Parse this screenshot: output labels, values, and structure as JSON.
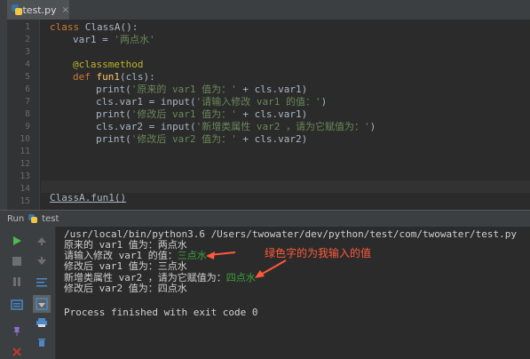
{
  "editor": {
    "tab": {
      "label": "test.py",
      "close": "×"
    },
    "line_numbers": [
      "1",
      "2",
      "3",
      "4",
      "5",
      "6",
      "7",
      "8",
      "9",
      "10",
      "11",
      "12",
      "13",
      "14",
      "15"
    ],
    "code": {
      "l1_kw": "class ",
      "l1_name": "ClassA():",
      "l2_a": "var1 = ",
      "l2_str": "'两点水'",
      "l4_dec": "@classmethod",
      "l5_kw": "def ",
      "l5_fn": "fun1",
      "l5_rest": "(cls):",
      "l6_a": "print(",
      "l6_str": "'原来的 var1 值为：'",
      "l6_b": " + cls.var1)",
      "l7_a": "cls.var1 = input(",
      "l7_str": "'请输入修改 var1 的值：'",
      "l7_b": ")",
      "l8_a": "print(",
      "l8_str": "'修改后 var1 值为：'",
      "l8_b": " + cls.var1)",
      "l9_a": "cls.var2 = input(",
      "l9_str": "'新增类属性 var2 ，请为它赋值为：'",
      "l9_b": ")",
      "l10_a": "print(",
      "l10_str": "'修改后 var2 值为：'",
      "l10_b": " + cls.var2)",
      "l14": "ClassA.fun1()"
    }
  },
  "run": {
    "label": "Run",
    "config": "test",
    "command": "/usr/local/bin/python3.6 /Users/twowater/dev/python/test/com/twowater/test.py",
    "out1": "原来的 var1 值为：两点水",
    "out2_prompt": "请输入修改 var1 的值：",
    "out2_input": "三点水",
    "out3": "修改后 var1 值为：三点水",
    "out4_prompt": "新增类属性 var2 ，请为它赋值为：",
    "out4_input": "四点水",
    "out5": "修改后 var2 值为：四点水",
    "finished": "Process finished with exit code 0"
  },
  "annotation": "绿色字的为我输入的值",
  "colors": {
    "accent_arrow": "#ff5a3c",
    "user_input": "#3aa23a",
    "run_button": "#4fb84f",
    "stop_button": "#c0392b"
  },
  "icons": [
    "run-icon",
    "stop-icon",
    "pause-icon",
    "up-icon",
    "down-icon",
    "soft-wrap-icon",
    "scroll-end-icon",
    "print-icon",
    "trash-icon",
    "pin-icon",
    "close-icon"
  ]
}
